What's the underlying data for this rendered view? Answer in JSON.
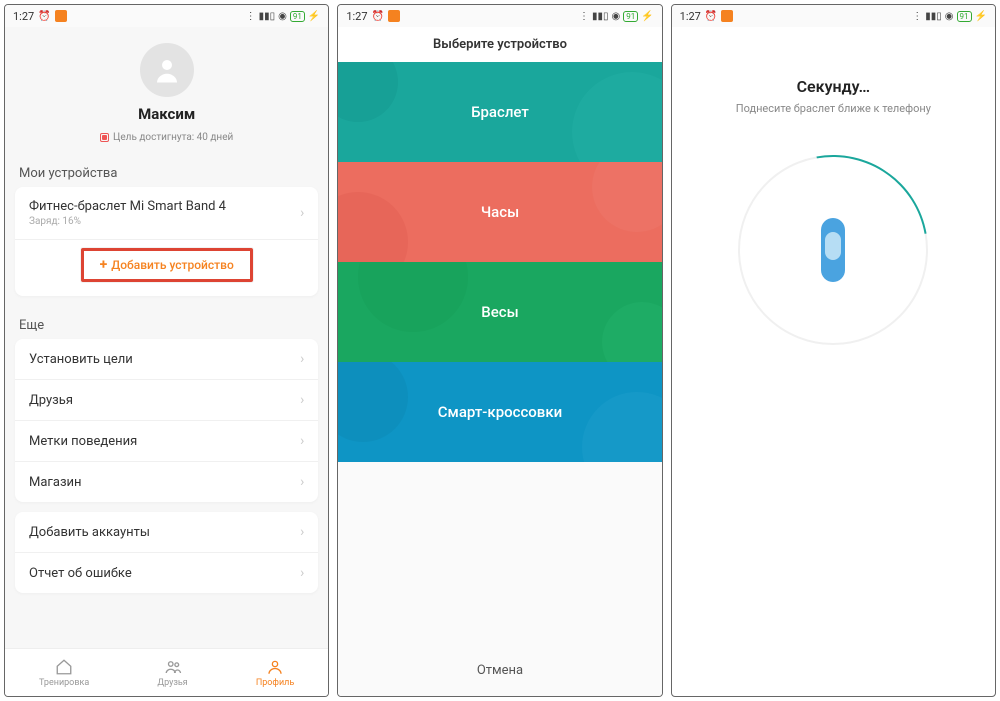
{
  "statusbar": {
    "time": "1:27",
    "battery": "91"
  },
  "screen1": {
    "username": "Максим",
    "goal_text": "Цель достигнута: 40 дней",
    "section_devices": "Мои устройства",
    "device_name": "Фитнес-браслет Mi Smart Band 4",
    "device_sub": "Заряд: 16%",
    "add_device": "Добавить устройство",
    "section_more": "Еще",
    "more_items": [
      "Установить цели",
      "Друзья",
      "Метки поведения",
      "Магазин"
    ],
    "extra_items": [
      "Добавить аккаунты",
      "Отчет об ошибке"
    ],
    "nav": {
      "workout": "Тренировка",
      "friends": "Друзья",
      "profile": "Профиль"
    }
  },
  "screen2": {
    "header": "Выберите устройство",
    "tiles": [
      "Браслет",
      "Часы",
      "Весы",
      "Смарт-кроссовки"
    ],
    "cancel": "Отмена"
  },
  "screen3": {
    "title": "Секунду…",
    "subtitle": "Поднесите браслет ближе к телефону"
  }
}
